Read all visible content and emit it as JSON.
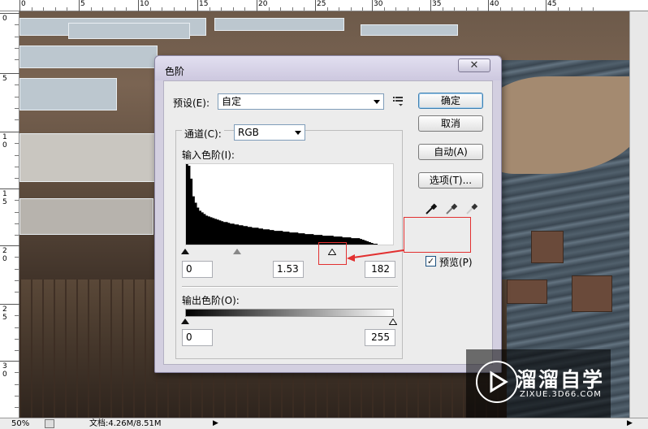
{
  "ruler_top": [
    "0",
    "5",
    "10",
    "15",
    "20",
    "25",
    "30",
    "35",
    "40",
    "45"
  ],
  "ruler_left": [
    "0",
    "5",
    "10",
    "15",
    "20",
    "25",
    "30"
  ],
  "status": {
    "zoom": "50%",
    "doc_info": "文档:4.26M/8.51M"
  },
  "dialog": {
    "title": "色阶",
    "preset_label": "预设(E):",
    "preset_value": "自定",
    "channel_label": "通道(C):",
    "channel_value": "RGB",
    "input_levels_label": "输入色阶(I):",
    "input_black": "0",
    "input_mid": "1.53",
    "input_white": "182",
    "output_levels_label": "输出色阶(O):",
    "output_black": "0",
    "output_white": "255",
    "buttons": {
      "ok": "确定",
      "cancel": "取消",
      "auto": "自动(A)",
      "options": "选项(T)..."
    },
    "preview_label": "预览(P)",
    "preview_checked": true,
    "close_glyph": "✕",
    "check_glyph": "✓",
    "histogram": [
      100,
      98,
      82,
      60,
      52,
      46,
      42,
      40,
      38,
      36,
      35,
      34,
      33,
      32,
      31,
      30,
      29,
      28,
      28,
      27,
      26,
      26,
      25,
      25,
      24,
      24,
      23,
      23,
      22,
      22,
      21,
      21,
      21,
      20,
      20,
      19,
      19,
      19,
      18,
      18,
      17,
      17,
      17,
      17,
      16,
      16,
      16,
      15,
      15,
      15,
      15,
      14,
      14,
      14,
      13,
      13,
      13,
      13,
      12,
      12,
      12,
      12,
      11,
      11,
      11,
      11,
      11,
      10,
      10,
      10,
      10,
      9,
      9,
      9,
      9,
      8,
      8,
      8,
      8,
      7,
      6,
      5,
      4,
      3,
      2,
      1,
      1,
      0,
      0,
      0,
      0,
      0,
      0,
      0
    ]
  },
  "watermark": {
    "title": "溜溜自学",
    "url": "ZIXUE.3D66.COM"
  }
}
